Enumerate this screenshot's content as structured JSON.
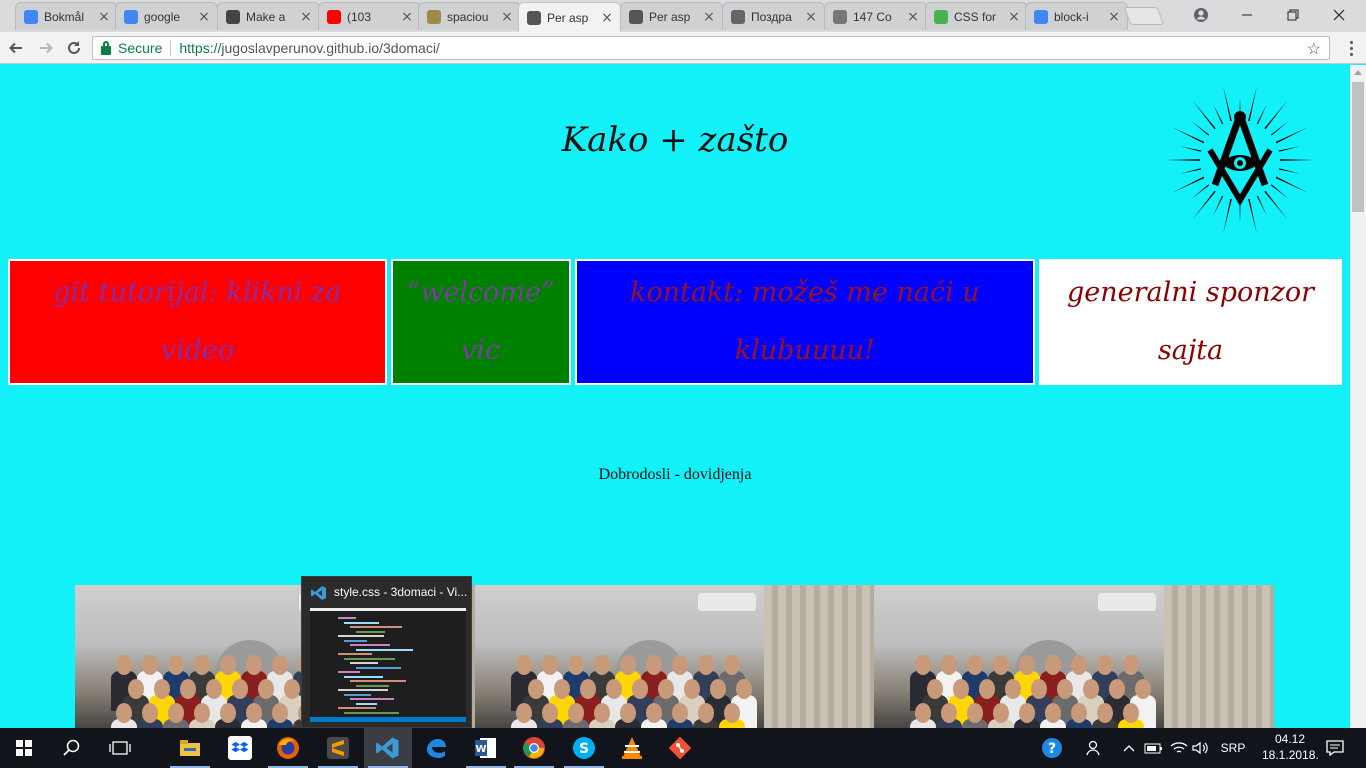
{
  "browser": {
    "tabs": [
      {
        "title": "Bokmål",
        "icon": "maps-icon",
        "color": "#4285f4"
      },
      {
        "title": "google",
        "icon": "google-icon",
        "color": "#4285f4"
      },
      {
        "title": "Make a",
        "icon": "codepen-icon",
        "color": "#444444"
      },
      {
        "title": "(103",
        "icon": "youtube-icon",
        "color": "#ff0000"
      },
      {
        "title": "spaciou",
        "icon": "spaceship-icon",
        "color": "#9e8a4a"
      },
      {
        "title": "Per asp",
        "icon": "github-page-icon",
        "color": "#555555"
      },
      {
        "title": "Per asp",
        "icon": "github-page-icon",
        "color": "#555555"
      },
      {
        "title": "Поздра",
        "icon": "globe-icon",
        "color": "#666666"
      },
      {
        "title": "147 Co",
        "icon": "document-icon",
        "color": "#777777"
      },
      {
        "title": "CSS for",
        "icon": "w3schools-icon",
        "color": "#4caf50"
      },
      {
        "title": "block-i",
        "icon": "google-icon",
        "color": "#4285f4"
      }
    ],
    "active_tab_index": 5,
    "security_label": "Secure",
    "url_protocol": "https://",
    "url_rest": "jugoslavperunov.github.io/3domaci/"
  },
  "page": {
    "title": "Kako + zašto",
    "logo_icon": "masonic-eye-icon",
    "menu": [
      {
        "text": "git tutorijal: klikni za video",
        "bg": "#ff0000"
      },
      {
        "text": "“welcome” vic",
        "bg": "#008000"
      },
      {
        "text": "kontakt: možeš me naći u klubuuuu!",
        "bg": "#0000ff"
      },
      {
        "text": "generalni sponzor sajta",
        "bg": "#ffffff"
      }
    ],
    "welcome": "Dobrodosli - dovidjenja",
    "photo_count": 3
  },
  "taskbar_preview": {
    "title": "style.css - 3domaci - Vi...",
    "icon": "vscode-icon"
  },
  "taskbar": {
    "apps": [
      "start-icon",
      "search-icon",
      "task-view-icon",
      "file-explorer-icon",
      "dropbox-icon",
      "firefox-icon",
      "sublime-icon",
      "vscode-icon",
      "edge-icon",
      "word-icon",
      "chrome-icon",
      "skype-icon",
      "vlc-icon",
      "git-icon"
    ],
    "language": "SRP",
    "time": "04.12",
    "date": "18.1.2018."
  }
}
